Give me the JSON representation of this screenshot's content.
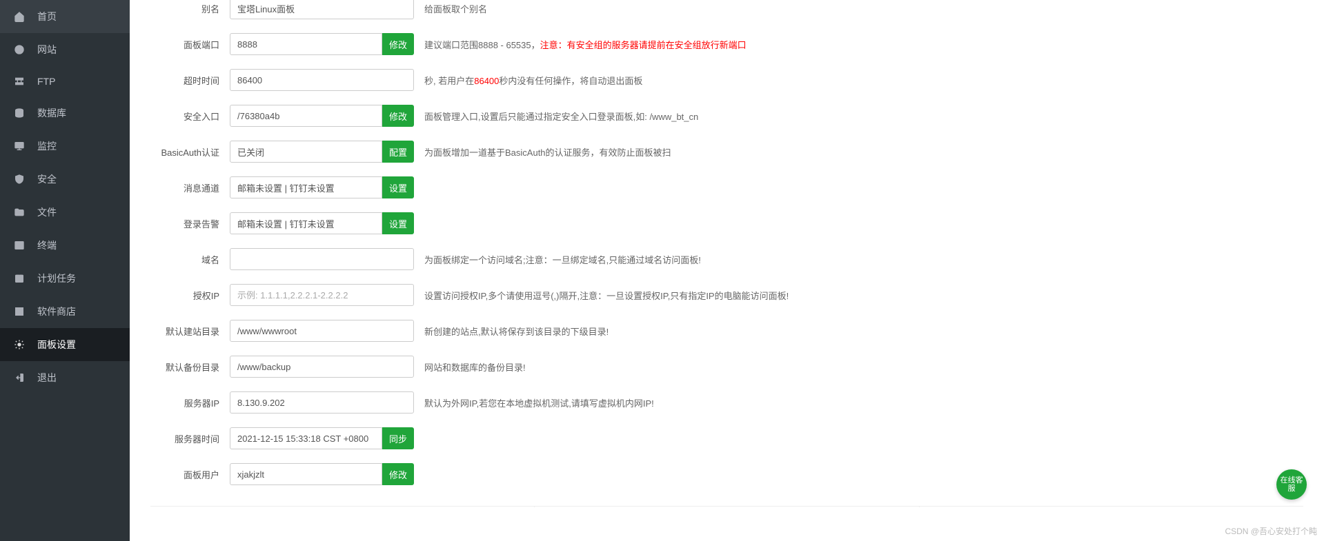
{
  "sidebar": {
    "items": [
      {
        "key": "home",
        "label": "首页"
      },
      {
        "key": "site",
        "label": "网站"
      },
      {
        "key": "ftp",
        "label": "FTP"
      },
      {
        "key": "db",
        "label": "数据库"
      },
      {
        "key": "monitor",
        "label": "监控"
      },
      {
        "key": "security",
        "label": "安全"
      },
      {
        "key": "files",
        "label": "文件"
      },
      {
        "key": "terminal",
        "label": "终端"
      },
      {
        "key": "cron",
        "label": "计划任务"
      },
      {
        "key": "store",
        "label": "软件商店"
      },
      {
        "key": "settings",
        "label": "面板设置"
      },
      {
        "key": "exit",
        "label": "退出"
      }
    ]
  },
  "form": {
    "alias": {
      "label": "别名",
      "value": "宝塔Linux面板",
      "hint": "给面板取个别名"
    },
    "port": {
      "label": "面板端口",
      "value": "8888",
      "btn": "修改",
      "hint_a": "建议端口范围8888 - 65535，",
      "hint_b": "注意：有安全组的服务器请提前在安全组放行新端口"
    },
    "timeout": {
      "label": "超时时间",
      "value": "86400",
      "hint_a": "秒, 若用户在",
      "hint_red": "86400",
      "hint_b": "秒内没有任何操作，将自动退出面板"
    },
    "entry": {
      "label": "安全入口",
      "value": "/76380a4b",
      "btn": "修改",
      "hint": "面板管理入口,设置后只能通过指定安全入口登录面板,如: /www_bt_cn"
    },
    "basicauth": {
      "label": "BasicAuth认证",
      "value": "已关闭",
      "btn": "配置",
      "hint": "为面板增加一道基于BasicAuth的认证服务，有效防止面板被扫"
    },
    "msg": {
      "label": "消息通道",
      "value": "邮箱未设置 | 钉钉未设置",
      "btn": "设置"
    },
    "alert": {
      "label": "登录告警",
      "value": "邮箱未设置 | 钉钉未设置",
      "btn": "设置"
    },
    "domain": {
      "label": "域名",
      "value": "",
      "hint": "为面板绑定一个访问域名;注意：一旦绑定域名,只能通过域名访问面板!"
    },
    "ip": {
      "label": "授权IP",
      "placeholder": "示例: 1.1.1.1,2.2.2.1-2.2.2.2",
      "hint": "设置访问授权IP,多个请使用逗号(,)隔开,注意：一旦设置授权IP,只有指定IP的电脑能访问面板!"
    },
    "siteDir": {
      "label": "默认建站目录",
      "value": "/www/wwwroot",
      "hint": "新创建的站点,默认将保存到该目录的下级目录!"
    },
    "backupDir": {
      "label": "默认备份目录",
      "value": "/www/backup",
      "hint": "网站和数据库的备份目录!"
    },
    "serverIp": {
      "label": "服务器IP",
      "value": "8.130.9.202",
      "hint": "默认为外网IP,若您在本地虚拟机测试,请填写虚拟机内网IP!"
    },
    "serverTime": {
      "label": "服务器时间",
      "value": "2021-12-15 15:33:18 CST +0800",
      "btn": "同步"
    },
    "panelUser": {
      "label": "面板用户",
      "value": "xjakjzlt",
      "btn": "修改"
    }
  },
  "float_btn": "在线客服",
  "watermark": "CSDN @吾心安处打个盹"
}
